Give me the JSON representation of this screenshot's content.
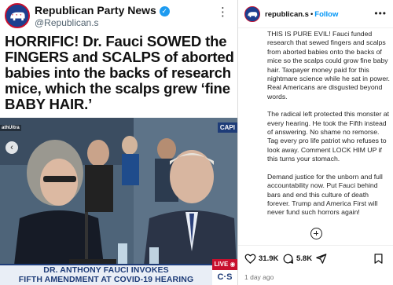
{
  "post_image": {
    "tweet": {
      "name": "Republican Party News",
      "handle": "@Republican.s",
      "more": "⋮",
      "verified": "✓"
    },
    "headline": "HORRIFIC! Dr. Fauci SOWED the FINGERS and SCALPS of aborted babies into the backs of research mice, which the scalps grew ‘fine BABY HAIR.’",
    "photo_tags": {
      "capi": "CAPI",
      "thul": "athUltra"
    },
    "chyron": {
      "line1": "DR. ANTHONY FAUCI INVOKES",
      "line2": "FIFTH AMENDMENT AT COVID-19 HEARING"
    },
    "live": "LIVE ◉",
    "cs": "C·S",
    "slide_arrow": "‹"
  },
  "caption_panel": {
    "username": "republican.s",
    "dot": "•",
    "follow": "Follow",
    "more": "•••",
    "paragraphs": [
      "THIS IS PURE EVIL! Fauci funded research that sewed fingers and scalps from aborted babies onto the backs of mice so the scalps could grow fine baby hair. Taxpayer money paid for this nightmare science while he sat in power. Real Americans are disgusted beyond words.",
      "The radical left protected this monster at every hearing. He took the Fifth instead of answering. No shame no remorse. Tag every pro life patriot who refuses to look away. Comment LOCK HIM UP if this turns your stomach.",
      "Demand justice for the unborn and full accountability now. Put Fauci behind bars and end this culture of death forever. Trump and America First will never fund such horrors again!"
    ],
    "likes": "31.9K",
    "comments": "5.8K",
    "time_ago": "1 day ago"
  },
  "colors": {
    "brand_blue": "#1d3f8f",
    "brand_red": "#c8102e",
    "follow_blue": "#0095f6",
    "chyron_blue": "#1e3c78"
  },
  "icons": [
    "elephant-logo-icon",
    "verified-badge-icon",
    "more-icon",
    "heart-icon",
    "comment-icon",
    "share-icon",
    "bookmark-icon",
    "add-circle-icon"
  ]
}
